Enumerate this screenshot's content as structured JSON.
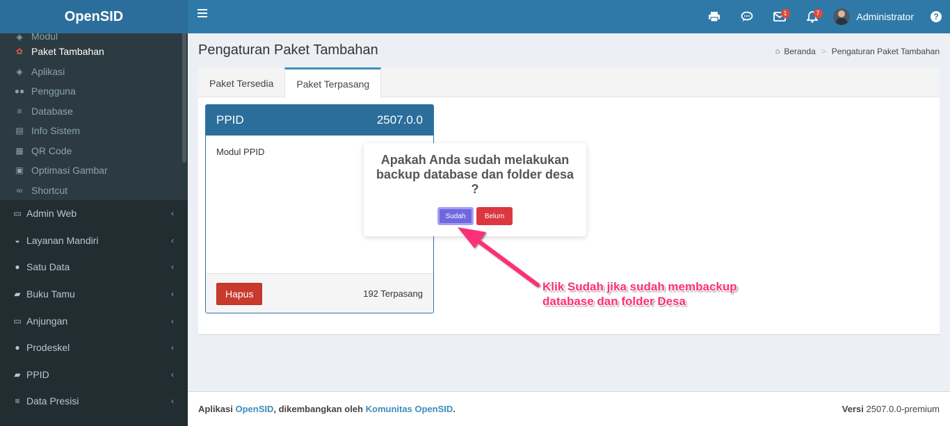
{
  "app": {
    "logo": "OpenSID"
  },
  "header": {
    "messages_badge": "1",
    "notifications_badge": "7",
    "user_name": "Administrator",
    "help_label": "?"
  },
  "sidebar": {
    "partial_item": "Modul",
    "sub_items": [
      {
        "label": "Paket Tambahan",
        "icon": "puzzle-icon"
      },
      {
        "label": "Aplikasi",
        "icon": "cube-icon"
      },
      {
        "label": "Pengguna",
        "icon": "users-icon"
      },
      {
        "label": "Database",
        "icon": "database-icon"
      },
      {
        "label": "Info Sistem",
        "icon": "server-icon"
      },
      {
        "label": "QR Code",
        "icon": "qrcode-icon"
      },
      {
        "label": "Optimasi Gambar",
        "icon": "image-icon"
      },
      {
        "label": "Shortcut",
        "icon": "link-icon"
      }
    ],
    "main_items": [
      {
        "label": "Admin Web",
        "icon": "desktop-icon"
      },
      {
        "label": "Layanan Mandiri",
        "icon": "inbox-icon"
      },
      {
        "label": "Satu Data",
        "icon": "globe-icon"
      },
      {
        "label": "Buku Tamu",
        "icon": "book-icon"
      },
      {
        "label": "Anjungan",
        "icon": "desktop-icon"
      },
      {
        "label": "Prodeskel",
        "icon": "globe-icon"
      },
      {
        "label": "PPID",
        "icon": "book-icon"
      },
      {
        "label": "Data Presisi",
        "icon": "database-icon"
      }
    ]
  },
  "page": {
    "title": "Pengaturan Paket Tambahan",
    "breadcrumb_home": "Beranda",
    "breadcrumb_current": "Pengaturan Paket Tambahan"
  },
  "tabs": [
    {
      "label": "Paket Tersedia"
    },
    {
      "label": "Paket Terpasang"
    }
  ],
  "package": {
    "name": "PPID",
    "version": "2507.0.0",
    "description": "Modul PPID",
    "delete_label": "Hapus",
    "installed_count": "192 Terpasang"
  },
  "footer": {
    "prefix": "Aplikasi",
    "app_link": "OpenSID",
    "middle": ", dikembangkan oleh",
    "community_link": "Komunitas OpenSID",
    "suffix": ".",
    "version_label": "Versi",
    "version_value": "2507.0.0-premium"
  },
  "dialog": {
    "title": "Apakah Anda sudah melakukan backup database dan folder desa ?",
    "confirm_label": "Sudah",
    "cancel_label": "Belum"
  },
  "annotation": {
    "line1": "Klik Sudah jika sudah membackup",
    "line2": "database dan folder Desa",
    "color": "#ff2d78"
  }
}
